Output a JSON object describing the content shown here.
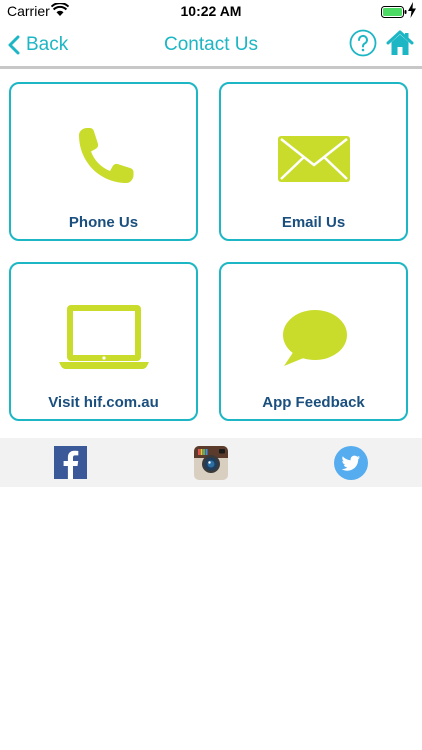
{
  "status_bar": {
    "carrier": "Carrier",
    "time": "10:22 AM"
  },
  "nav": {
    "back_label": "Back",
    "title": "Contact Us"
  },
  "tiles": [
    {
      "label": "Phone Us",
      "icon": "phone-icon"
    },
    {
      "label": "Email Us",
      "icon": "envelope-icon"
    },
    {
      "label": "Visit hif.com.au",
      "icon": "laptop-icon"
    },
    {
      "label": "App Feedback",
      "icon": "speech-bubble-icon"
    }
  ],
  "social": [
    "facebook-icon",
    "instagram-icon",
    "twitter-icon"
  ],
  "colors": {
    "accent": "#1db6c4",
    "icon_green": "#c9dc2c",
    "label_blue": "#1a4f7e",
    "social_bg": "#f2f2f2"
  }
}
